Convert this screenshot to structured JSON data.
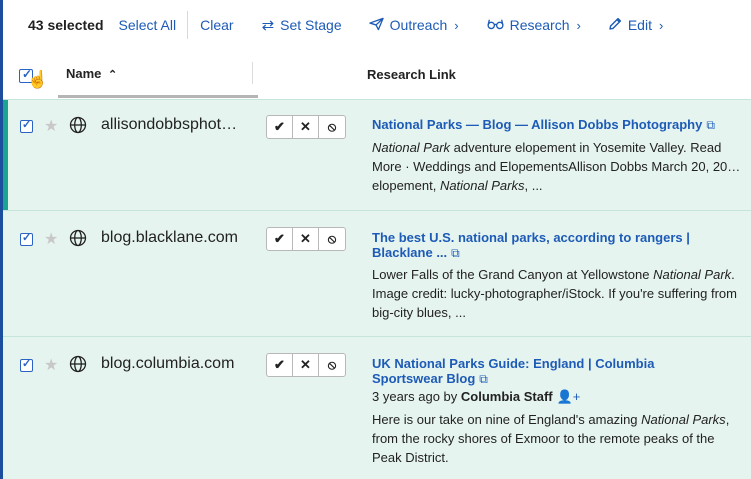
{
  "toolbar": {
    "selected_count": "43 selected",
    "select_all": "Select All",
    "clear": "Clear",
    "set_stage": "Set Stage",
    "outreach": "Outreach",
    "research": "Research",
    "edit": "Edit"
  },
  "header": {
    "name": "Name",
    "research_link": "Research Link"
  },
  "rows": [
    {
      "domain": "allisondobbsphot…",
      "title": "National Parks — Blog — Allison Dobbs Photography",
      "snippet_lines": [
        [
          "",
          "National Park",
          " adventure elopement in Yosemite Valley. Read"
        ],
        [
          "More · Weddings and ElopementsAllison Dobbs March 20, 20…",
          "",
          ""
        ],
        [
          "elopement, ",
          "National Parks",
          ", ..."
        ]
      ]
    },
    {
      "domain": "blog.blacklane.com",
      "title_line1": "The best U.S. national parks, according to rangers |",
      "title_line2": "Blacklane ...",
      "snippet_lines": [
        [
          "Lower Falls of the Grand Canyon at Yellowstone ",
          "National Park",
          "."
        ],
        [
          "Image credit: lucky-photographer/iStock. If you're suffering from",
          "",
          ""
        ],
        [
          "big-city blues, ...",
          "",
          ""
        ]
      ]
    },
    {
      "domain": "blog.columbia.com",
      "title_line1": "UK National Parks Guide: England | Columbia",
      "title_line2": "Sportswear Blog",
      "meta_prefix": "3 years ago by ",
      "meta_author": "Columbia Staff",
      "snippet_lines": [
        [
          "Here is our take on nine of England's amazing ",
          "National Parks",
          ","
        ],
        [
          "from the rocky shores of Exmoor to the remote peaks of the",
          "",
          ""
        ],
        [
          "Peak District.",
          "",
          ""
        ]
      ]
    }
  ],
  "colors": {
    "accent": "#1d5bb6",
    "row_bg": "#e6f4f0",
    "active_bar": "#19a592"
  }
}
